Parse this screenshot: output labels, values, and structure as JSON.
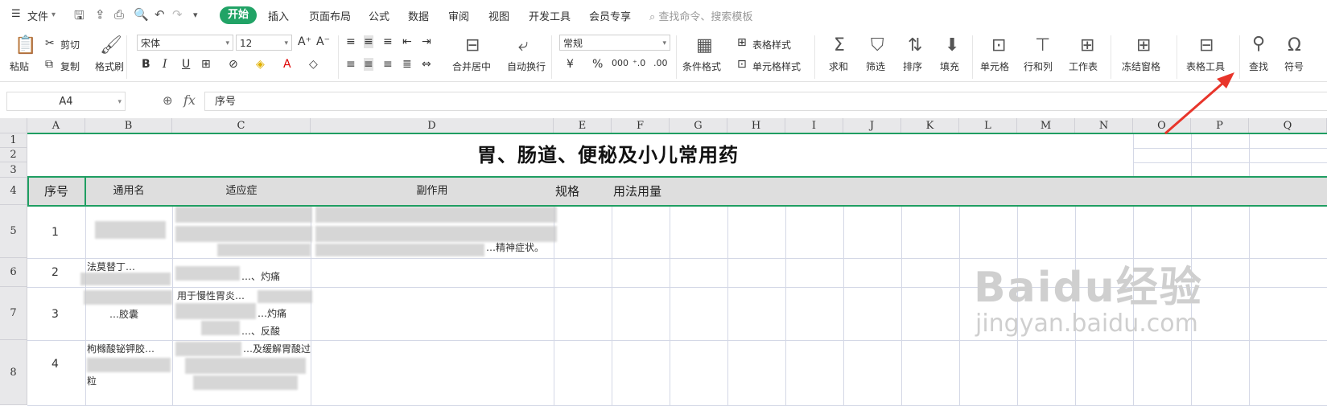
{
  "menubar": {
    "file": "文件",
    "tabs": [
      "开始",
      "插入",
      "页面布局",
      "公式",
      "数据",
      "审阅",
      "视图",
      "开发工具",
      "会员专享"
    ],
    "search_placeholder": "查找命令、搜索模板"
  },
  "ribbon": {
    "clipboard": {
      "paste": "粘贴",
      "cut": "剪切",
      "copy": "复制",
      "format_painter": "格式刷"
    },
    "font": {
      "name": "宋体",
      "size": "12"
    },
    "alignment": {
      "merge": "合并居中",
      "wrap": "自动换行"
    },
    "number": {
      "format": "常规"
    },
    "styles": {
      "conditional": "条件格式",
      "table_style": "表格样式",
      "cell_style": "单元格样式"
    },
    "editing": {
      "sum": "求和",
      "filter": "筛选",
      "sort": "排序",
      "fill": "填充",
      "cell": "单元格",
      "row_col": "行和列",
      "sheet": "工作表",
      "freeze": "冻结窗格",
      "table_tools": "表格工具",
      "find": "查找",
      "symbol": "符号"
    }
  },
  "formula_bar": {
    "name_box": "A4",
    "formula": "序号"
  },
  "sheet": {
    "columns": [
      "A",
      "B",
      "C",
      "D",
      "E",
      "F",
      "G",
      "H",
      "I",
      "J",
      "K",
      "L",
      "M",
      "N",
      "O",
      "P",
      "Q"
    ],
    "rows": [
      "1",
      "2",
      "3",
      "4",
      "5",
      "6",
      "7",
      "8"
    ],
    "title": "胃、肠道、便秘及小儿常用药",
    "headers": [
      "序号",
      "通用名",
      "适应症",
      "副作用",
      "规格",
      "用法用量"
    ],
    "data_rows": [
      {
        "seq": "1",
        "name": "",
        "indication": "",
        "side": "…精神症状。"
      },
      {
        "seq": "2",
        "name": "法莫替丁…",
        "indication": "…、灼痛"
      },
      {
        "seq": "3",
        "name": "…胶囊",
        "indication": "用于慢性胃炎…",
        "indication2": "…灼痛",
        "indication3": "…、反酸"
      },
      {
        "seq": "4",
        "name": "枸橼酸铋钾胶…",
        "indication": "…及缓解胃酸过",
        "name2": "粒"
      }
    ]
  },
  "watermark": {
    "brand": "Baidu经验",
    "url": "jingyan.baidu.com"
  },
  "colors": {
    "accent": "#21a366",
    "selection": "#1f9e62",
    "arrow": "#e8352b"
  }
}
